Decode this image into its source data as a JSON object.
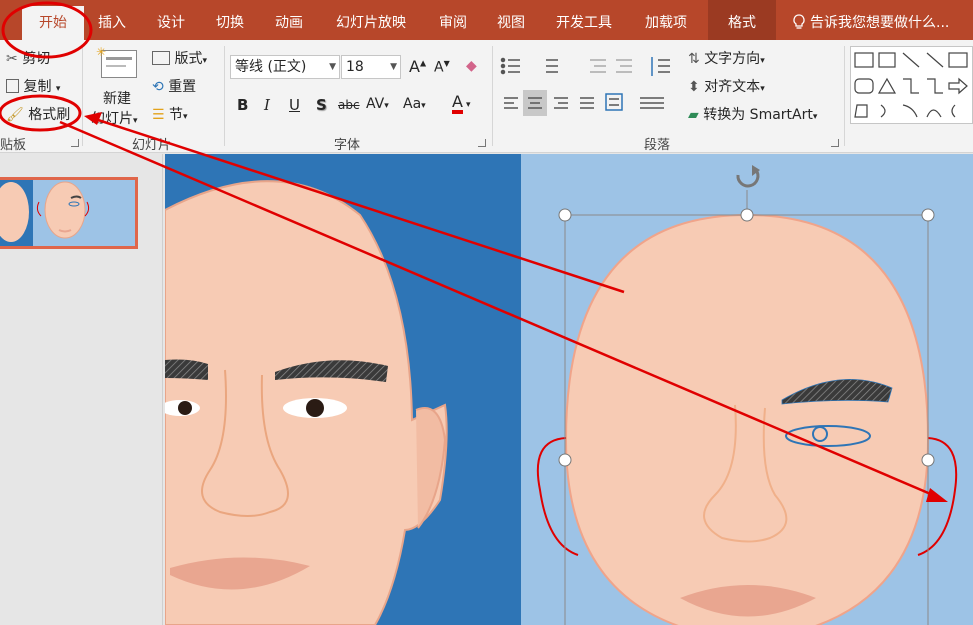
{
  "tabs": [
    {
      "label": "开始",
      "active": true
    },
    {
      "label": "插入"
    },
    {
      "label": "设计"
    },
    {
      "label": "切换"
    },
    {
      "label": "动画"
    },
    {
      "label": "幻灯片放映"
    },
    {
      "label": "审阅"
    },
    {
      "label": "视图"
    },
    {
      "label": "开发工具"
    },
    {
      "label": "加载项"
    },
    {
      "label": "格式"
    }
  ],
  "tell_me": "告诉我您想要做什么...",
  "clipboard": {
    "cut": "剪切",
    "copy": "复制",
    "format_painter": "格式刷",
    "group_label": "贴板"
  },
  "slides": {
    "new_slide_line1": "新建",
    "new_slide_line2": "幻灯片",
    "layout": "版式",
    "reset": "重置",
    "section": "节",
    "group_label": "幻灯片"
  },
  "font": {
    "name": "等线 (正文)",
    "size": "18",
    "grow": "A",
    "shrink": "A",
    "bold": "B",
    "italic": "I",
    "underline": "U",
    "shadow": "S",
    "strike": "abc",
    "spacing": "AV",
    "case": "Aa",
    "color_letter": "A",
    "group_label": "字体"
  },
  "paragraph": {
    "text_direction": "文字方向",
    "align_text": "对齐文本",
    "convert_smartart": "转换为 SmartArt",
    "group_label": "段落"
  },
  "colors": {
    "accent": "#b7472a",
    "annotation": "#e00000",
    "slide_dark_blue": "#2e75b6",
    "slide_light_blue": "#9dc3e6",
    "skin": "#f7cbb4"
  }
}
